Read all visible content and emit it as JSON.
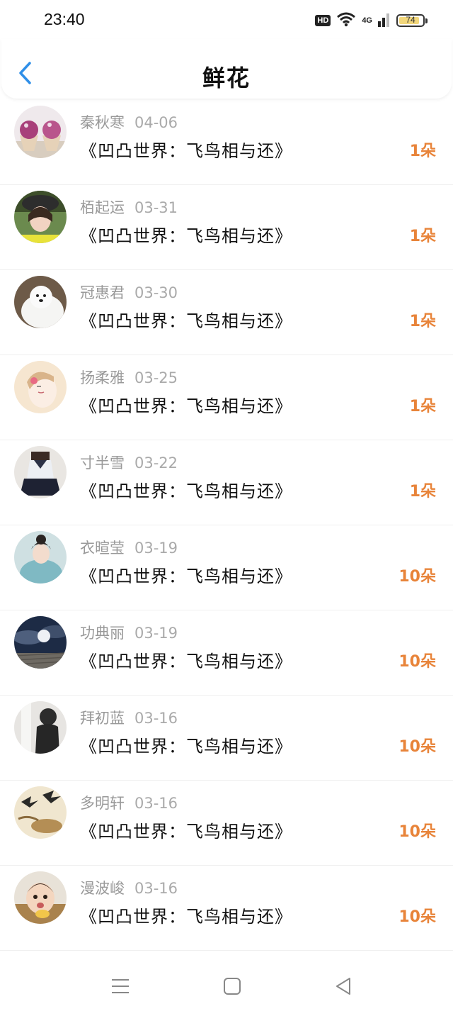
{
  "status": {
    "time": "23:40",
    "hd": "HD",
    "network": "4G",
    "battery": "74"
  },
  "header": {
    "title": "鲜花",
    "back_icon": "chevron-left-icon"
  },
  "colors": {
    "accent": "#2f8fe8",
    "count": "#e8843a"
  },
  "list": {
    "items": [
      {
        "user": "秦秋寒",
        "date": "04-06",
        "book": "《凹凸世界：飞鸟相与还》",
        "count": "1朵",
        "avatar": "cupcakes"
      },
      {
        "user": "栢起运",
        "date": "03-31",
        "book": "《凹凸世界：飞鸟相与还》",
        "count": "1朵",
        "avatar": "girl-hat"
      },
      {
        "user": "冠惠君",
        "date": "03-30",
        "book": "《凹凸世界：飞鸟相与还》",
        "count": "1朵",
        "avatar": "white-dog"
      },
      {
        "user": "扬柔雅",
        "date": "03-25",
        "book": "《凹凸世界：飞鸟相与还》",
        "count": "1朵",
        "avatar": "painted-girl"
      },
      {
        "user": "寸半雪",
        "date": "03-22",
        "book": "《凹凸世界：飞鸟相与还》",
        "count": "1朵",
        "avatar": "uniform"
      },
      {
        "user": "衣暄莹",
        "date": "03-19",
        "book": "《凹凸世界：飞鸟相与还》",
        "count": "10朵",
        "avatar": "hanfu-girl"
      },
      {
        "user": "功典丽",
        "date": "03-19",
        "book": "《凹凸世界：飞鸟相与还》",
        "count": "10朵",
        "avatar": "night-moon"
      },
      {
        "user": "拜初蓝",
        "date": "03-16",
        "book": "《凹凸世界：飞鸟相与还》",
        "count": "10朵",
        "avatar": "sad-figure"
      },
      {
        "user": "多明轩",
        "date": "03-16",
        "book": "《凹凸世界：飞鸟相与还》",
        "count": "10朵",
        "avatar": "swallows"
      },
      {
        "user": "漫波峻",
        "date": "03-16",
        "book": "《凹凸世界：飞鸟相与还》",
        "count": "10朵",
        "avatar": "baby"
      }
    ]
  },
  "nav": {
    "menu_icon": "menu-icon",
    "home_icon": "home-square-icon",
    "back_icon": "back-triangle-icon"
  }
}
